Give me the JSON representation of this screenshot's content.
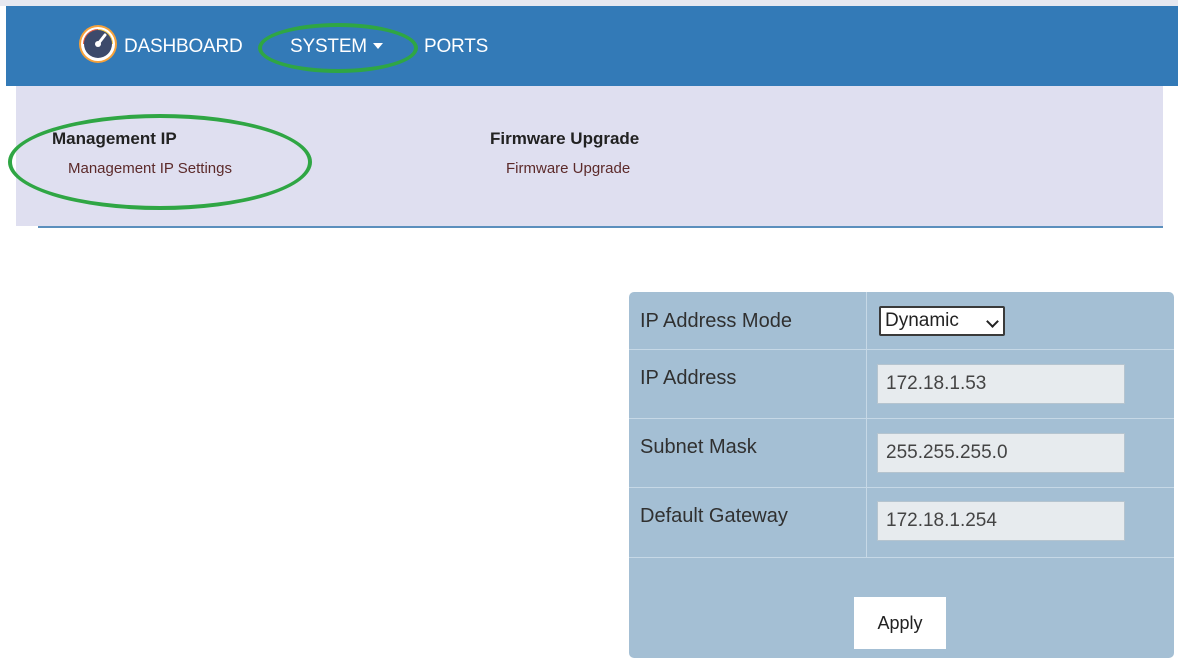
{
  "nav": {
    "dashboard": "DASHBOARD",
    "system": "SYSTEM",
    "ports": "PORTS"
  },
  "submenu": {
    "groups": [
      {
        "heading": "Management IP",
        "link": "Management IP Settings"
      },
      {
        "heading": "Firmware Upgrade",
        "link": "Firmware Upgrade"
      }
    ]
  },
  "form": {
    "rows": [
      {
        "label": "IP Address Mode",
        "value": "Dynamic"
      },
      {
        "label": "IP Address",
        "value": "172.18.1.53"
      },
      {
        "label": "Subnet Mask",
        "value": "255.255.255.0"
      },
      {
        "label": "Default Gateway",
        "value": "172.18.1.254"
      }
    ],
    "apply_label": "Apply"
  },
  "icons": {
    "logo": "gauge-icon",
    "system_menu": "caret-down-icon"
  },
  "colors": {
    "navbar": "#337ab7",
    "submenu": "#dfdff0",
    "panel": "#a4bfd4",
    "highlight": "#2fa644"
  }
}
